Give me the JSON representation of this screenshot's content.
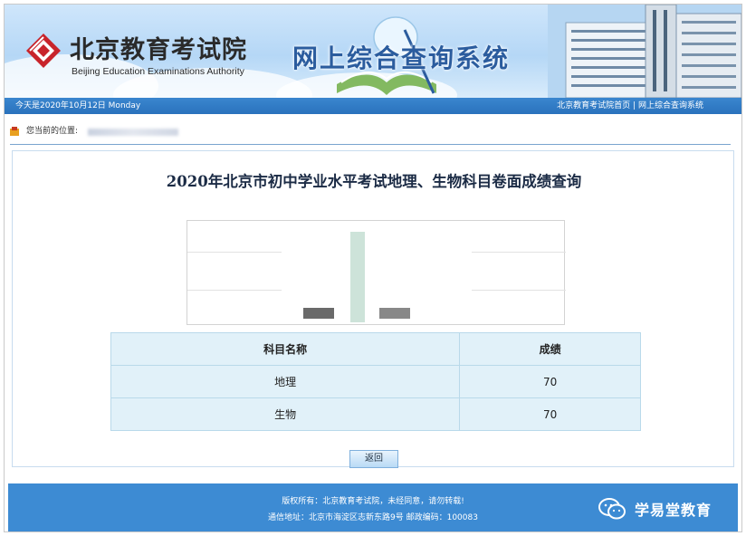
{
  "header": {
    "org_name_cn": "北京教育考试院",
    "org_name_en": "Beijing Education Examinations Authority",
    "system_title": "网上综合查询系统"
  },
  "infobar": {
    "date_text": "今天是2020年10月12日 Monday",
    "link_home": "北京教育考试院首页",
    "separator": "|",
    "link_system": "网上综合查询系统"
  },
  "breadcrumb": {
    "label": "您当前的位置:"
  },
  "main": {
    "title": "2020年北京市初中学业水平考试地理、生物科目卷面成绩查询",
    "table": {
      "headers": [
        "科目名称",
        "成绩"
      ],
      "rows": [
        {
          "subject": "地理",
          "score": "70"
        },
        {
          "subject": "生物",
          "score": "70"
        }
      ]
    },
    "back_button": "返回"
  },
  "footer": {
    "copyright": "版权所有：北京教育考试院，未经同意，请勿转载!",
    "address": "通信地址：北京市海淀区志新东路9号 邮政编码：100083"
  },
  "watermark": {
    "name": "学易堂教育",
    "icon": "wechat-icon"
  },
  "colors": {
    "header_bar": "#2a72bd",
    "footer_bg": "#3d8bd3",
    "table_cell_bg": "#e1f1f9",
    "title_text": "#1b2b45",
    "system_title": "#2b5c9e"
  }
}
